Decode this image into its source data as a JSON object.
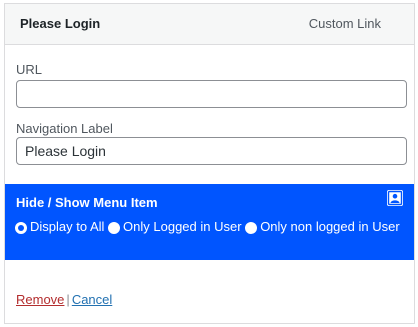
{
  "header": {
    "title": "Please Login",
    "type_label": "Custom Link"
  },
  "url_field": {
    "label": "URL",
    "value": ""
  },
  "nav_label_field": {
    "label": "Navigation Label",
    "value": "Please Login"
  },
  "visibility_box": {
    "title": "Hide / Show Menu Item",
    "icon": "user-profile-icon",
    "background_color": "#0055ff",
    "options": [
      {
        "label": "Display to All",
        "checked": true
      },
      {
        "label": "Only Logged in User",
        "checked": false
      },
      {
        "label": "Only non logged in User",
        "checked": false
      }
    ]
  },
  "actions": {
    "remove_label": "Remove",
    "separator": "|",
    "cancel_label": "Cancel"
  }
}
